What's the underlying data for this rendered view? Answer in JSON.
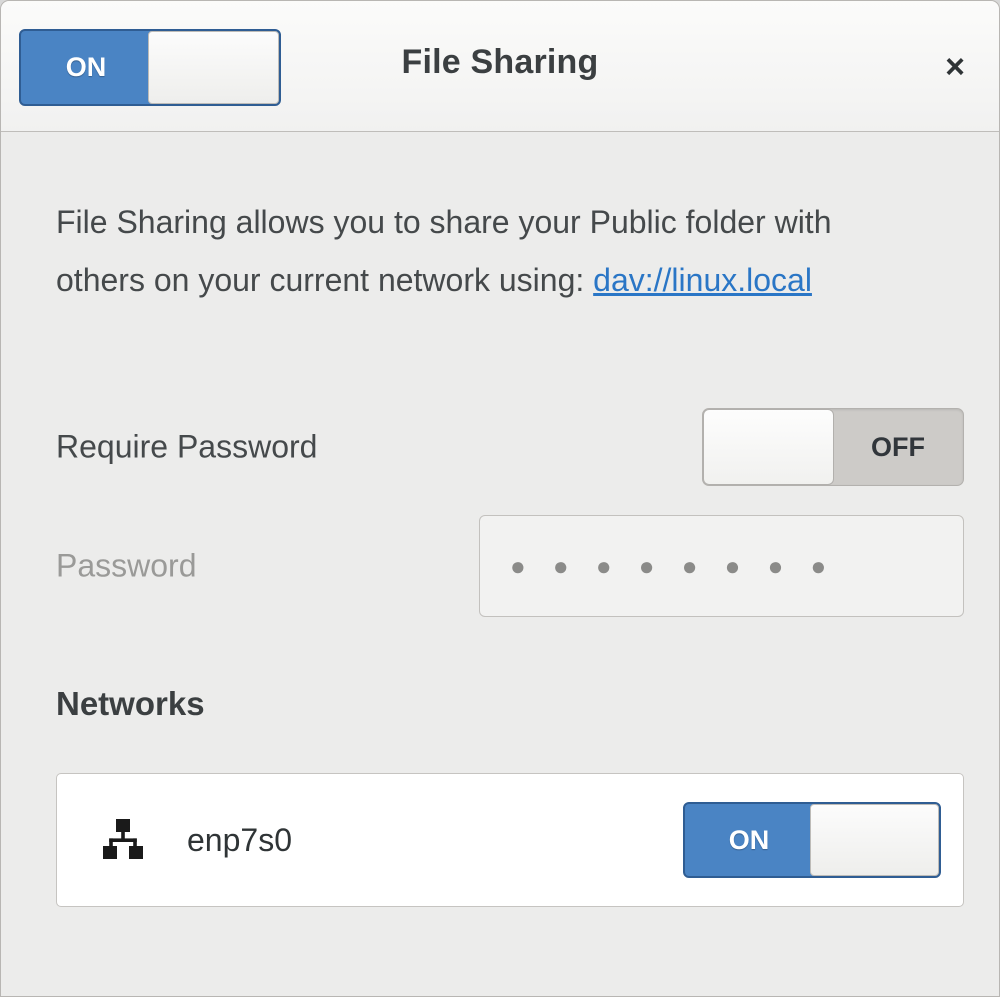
{
  "window": {
    "title": "File Sharing",
    "close_label": "×"
  },
  "header": {
    "master_switch": {
      "state_label": "ON",
      "state": "on",
      "icon": "toggle-switch"
    }
  },
  "content": {
    "description_prefix": "File Sharing allows you to share your Public folder with others on your current network using: ",
    "description_link": "dav://linux.local",
    "require_password": {
      "label": "Require Password",
      "state_label": "OFF",
      "state": "off"
    },
    "password": {
      "label": "Password",
      "value_mask": "● ● ● ● ● ● ● ●",
      "placeholder": "Password",
      "enabled": false
    },
    "networks": {
      "heading": "Networks",
      "items": [
        {
          "name": "enp7s0",
          "icon": "wired-network-icon",
          "state_label": "ON",
          "state": "on"
        }
      ]
    }
  },
  "colors": {
    "accent_on": "#4a84c4",
    "accent_on_border": "#2f5d93",
    "link": "#2a76c6",
    "switch_off_track": "#cdcbc8",
    "window_bg": "#ececeb",
    "header_bg": "#f6f6f5",
    "text": "#45494b",
    "text_disabled": "#9a9a98"
  }
}
